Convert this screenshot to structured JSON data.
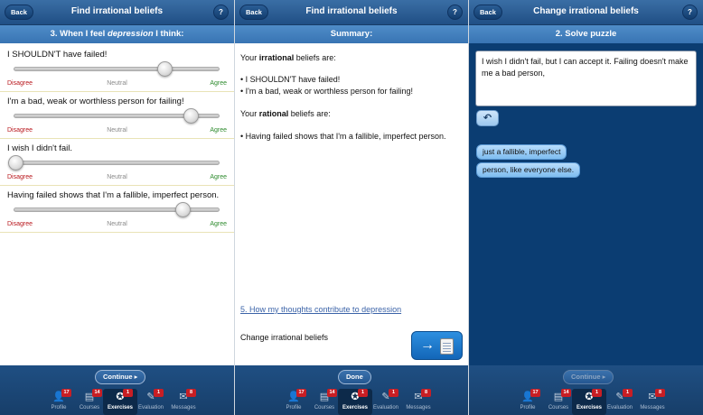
{
  "screens": [
    {
      "title": "Find irrational beliefs",
      "back_label": "Back",
      "help_label": "?",
      "subheader": {
        "prefix": "3. When I feel",
        "emotion": "depression",
        "suffix": "I think:"
      },
      "scale_labels": {
        "disagree": "Disagree",
        "neutral": "Neutral",
        "agree": "Agree"
      },
      "statements": [
        {
          "text": "I SHOULDN'T have failed!",
          "level": 0.74
        },
        {
          "text": "I'm a bad, weak or worthless person for failing!",
          "level": 0.87
        },
        {
          "text": "I wish I didn't fail.",
          "level": 0.0
        },
        {
          "text": "Having failed shows that I'm a fallible, imperfect person.",
          "level": 0.83
        }
      ],
      "action_label": "Continue ▸"
    },
    {
      "title": "Find irrational beliefs",
      "back_label": "Back",
      "help_label": "?",
      "subheader": "Summary:",
      "irrational_heading": {
        "pre": "Your",
        "bold": "irrational",
        "post": "beliefs are:"
      },
      "irrational_items": [
        "• I SHOULDN'T have failed!",
        "• I'm a bad, weak or worthless person for failing!"
      ],
      "rational_heading": {
        "pre": "Your",
        "bold": "rational",
        "post": "beliefs are:"
      },
      "rational_items": [
        "• Having failed shows that I'm a fallible, imperfect person."
      ],
      "link_text": "5. How my thoughts contribute to depression",
      "change_text": "Change irrational beliefs",
      "action_label": "Done"
    },
    {
      "title": "Change irrational beliefs",
      "back_label": "Back",
      "help_label": "?",
      "subheader": "2. Solve puzzle",
      "answer_text": "I wish I didn't fail, but I can accept it. Failing doesn't make me a bad person,",
      "undo_icon": "↶",
      "chips": [
        "just a fallible, imperfect",
        "person, like everyone else."
      ],
      "action_label": "Continue ▸"
    }
  ],
  "tabs": [
    {
      "label": "Profile",
      "badge": "17",
      "icon": "person-icon",
      "glyph": "👤"
    },
    {
      "label": "Courses",
      "badge": "14",
      "icon": "courses-icon",
      "glyph": "▤"
    },
    {
      "label": "Exercises",
      "badge": "1",
      "icon": "exercises-icon",
      "glyph": "✪"
    },
    {
      "label": "Evaluation",
      "badge": "1",
      "icon": "pencil-icon",
      "glyph": "✎"
    },
    {
      "label": "Messages",
      "badge": "8",
      "icon": "envelope-icon",
      "glyph": "✉"
    }
  ],
  "active_tab": "Exercises",
  "colors": {
    "navbar": "#204f85",
    "subbar": "#3874b3",
    "disagree": "#b8161c",
    "agree": "#2e8b2e",
    "dark_bg": "#0b3d72"
  }
}
